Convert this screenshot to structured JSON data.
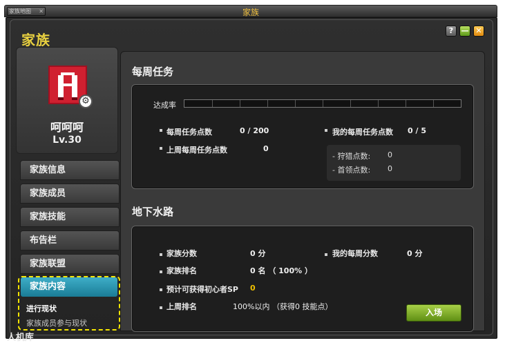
{
  "window": {
    "title": "家族",
    "mini_tab_label": "家族地图",
    "heading": "家族",
    "controls": {
      "help": "?",
      "minimize": "—",
      "close": "✕"
    }
  },
  "profile": {
    "emblem_letter": "A",
    "name": "呵呵呵",
    "level": "Lv.30"
  },
  "menu": {
    "items": [
      "家族信息",
      "家族成员",
      "家族技能",
      "布告栏",
      "家族联盟"
    ],
    "active": "家族内容",
    "sub_items": [
      "进行现状",
      "家族成员参与现状"
    ]
  },
  "weekly": {
    "title": "每周任务",
    "achievement_label": "达成率",
    "achievement_progress": 0,
    "weekly_points_label": "每周任务点数",
    "weekly_points_value": "0 / 200",
    "last_week_label": "上周每周任务点数",
    "last_week_value": "0",
    "my_points_label": "我的每周任务点数",
    "my_points_value": "0 / 5",
    "hunt_label": "- 狩猎点数:",
    "hunt_value": "0",
    "boss_label": "- 首领点数:",
    "boss_value": "0"
  },
  "underground": {
    "title": "地下水路",
    "family_score_label": "家族分数",
    "family_score_value": "0 分",
    "my_weekly_label": "我的每周分数",
    "my_weekly_value": "0 分",
    "family_rank_label": "家族排名",
    "family_rank_value": "0 名 （ 100% ）",
    "expected_sp_label": "预计可获得初心者SP",
    "expected_sp_value": "0",
    "last_rank_label": "上周排名",
    "last_rank_value": "100%以内 （获得0 技能点）",
    "enter_button": "入场"
  },
  "watermark": "人机库",
  "colors": {
    "accent_yellow": "#e8d040",
    "active_tab": "#2a9ab6",
    "enter_button": "#8ab830",
    "sp_value": "#f0c000",
    "highlight": "#f5e600"
  }
}
